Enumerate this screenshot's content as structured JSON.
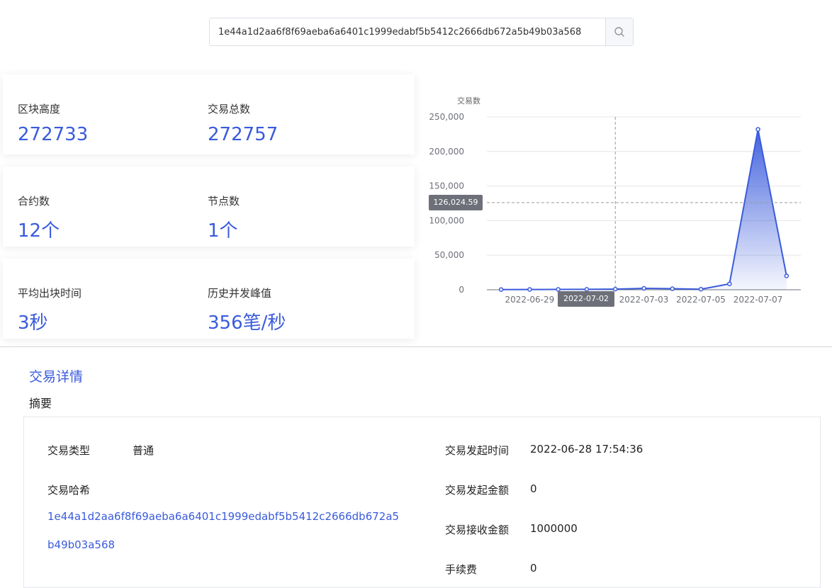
{
  "search": {
    "value": "1e44a1d2aa6f8f69aeba6a6401c1999edabf5b5412c2666db672a5b49b03a568",
    "icon": "search-icon"
  },
  "stats": {
    "block_height": {
      "label": "区块高度",
      "value": "272733"
    },
    "tx_total": {
      "label": "交易总数",
      "value": "272757"
    },
    "contracts": {
      "label": "合约数",
      "value": "12个"
    },
    "nodes": {
      "label": "节点数",
      "value": "1个"
    },
    "avg_block_time": {
      "label": "平均出块时间",
      "value": "3秒"
    },
    "peak_concurrency": {
      "label": "历史并发峰值",
      "value": "356笔/秒"
    }
  },
  "chart_tooltip": {
    "y_value": "126,024.59",
    "x_value": "2022-07-02"
  },
  "chart_data": {
    "type": "area",
    "title": "",
    "ylabel": "交易数",
    "x": [
      "2022-06-28",
      "2022-06-29",
      "2022-06-30",
      "2022-07-01",
      "2022-07-02",
      "2022-07-03",
      "2022-07-04",
      "2022-07-05",
      "2022-07-06",
      "2022-07-07",
      "2022-07-08"
    ],
    "xticks": [
      "2022-06-29",
      "2022-07-01",
      "2022-07-03",
      "2022-07-05",
      "2022-07-07"
    ],
    "values": [
      300,
      400,
      500,
      600,
      900,
      2000,
      1500,
      800,
      8500,
      232000,
      20000
    ],
    "ylim": [
      0,
      250000
    ],
    "yticks": [
      "0",
      "50,000",
      "100,000",
      "150,000",
      "200,000",
      "250,000"
    ],
    "grid": true,
    "color": "#3a5bdc"
  },
  "detail": {
    "section_title": "交易详情",
    "sub_title": "摘要",
    "tx_type_label": "交易类型",
    "tx_type_value": "普通",
    "tx_hash_label": "交易哈希",
    "tx_hash_line1": "1e44a1d2aa6f8f69aeba6a6401c1999edabf5b5412c2666db672a5",
    "tx_hash_line2": "b49b03a568",
    "tx_time_label": "交易发起时间",
    "tx_time_value": "2022-06-28 17:54:36",
    "send_amount_label": "交易发起金额",
    "send_amount_value": "0",
    "recv_amount_label": "交易接收金额",
    "recv_amount_value": "1000000",
    "fee_label": "手续费",
    "fee_value": "0"
  }
}
